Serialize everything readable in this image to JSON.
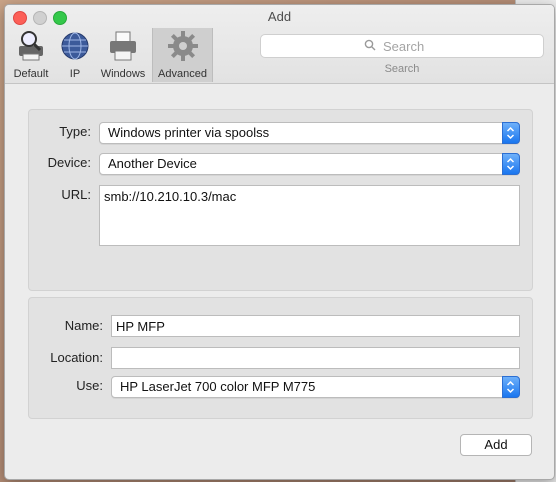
{
  "window": {
    "title": "Add"
  },
  "toolbar": {
    "items": [
      {
        "label": "Default",
        "icon": "magnifier-printer-icon"
      },
      {
        "label": "IP",
        "icon": "globe-icon"
      },
      {
        "label": "Windows",
        "icon": "printer-icon"
      },
      {
        "label": "Advanced",
        "icon": "gear-icon",
        "selected": true
      }
    ],
    "search": {
      "placeholder": "Search",
      "caption": "Search"
    }
  },
  "connection": {
    "type_label": "Type:",
    "type_value": "Windows printer via spoolss",
    "device_label": "Device:",
    "device_value": "Another Device",
    "url_label": "URL:",
    "url_value": "smb://10.210.10.3/mac"
  },
  "printer": {
    "name_label": "Name:",
    "name_value": "HP MFP",
    "location_label": "Location:",
    "location_value": "",
    "use_label": "Use:",
    "use_value": "HP LaserJet 700 color MFP M775"
  },
  "actions": {
    "add_label": "Add"
  },
  "colors": {
    "accent": "#1a76ef",
    "close": "#fc5f57",
    "zoom": "#34c84a"
  }
}
